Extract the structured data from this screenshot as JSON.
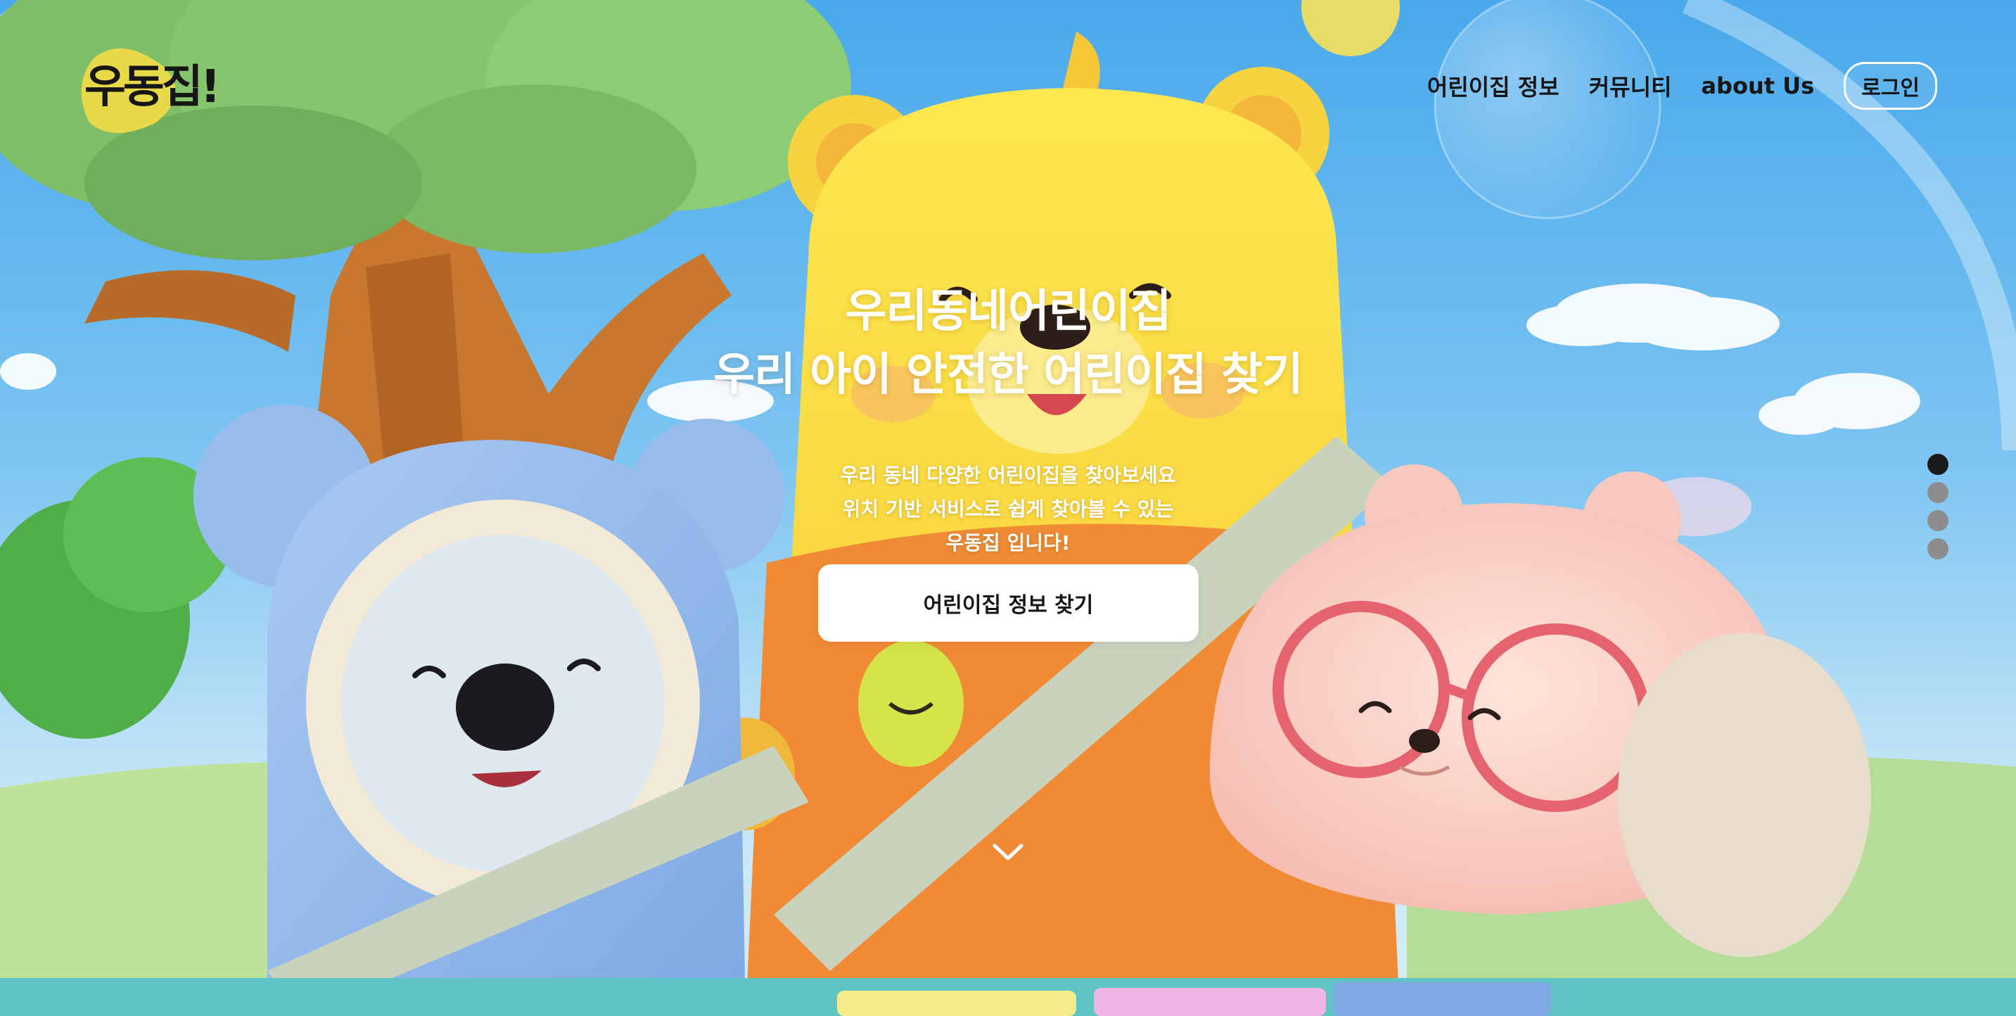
{
  "brand": {
    "logo_text": "우동집!",
    "logo_color": "#e8d94a"
  },
  "nav": {
    "items": [
      {
        "label": "어린이집 정보"
      },
      {
        "label": "커뮤니티"
      },
      {
        "label": "about Us"
      }
    ],
    "login_label": "로그인"
  },
  "hero": {
    "headline": [
      "우리동네어린이집",
      "우리 아이 안전한 어린이집 찾기"
    ],
    "subcopy": [
      "우리 동네 다양한 어린이집을 찾아보세요",
      "위치 기반 서비스로 쉽게 찾아볼 수 있는",
      "우동집 입니다!"
    ],
    "cta_label": "어린이집 정보 찾기",
    "scroll_icon": "chevron-down-icon"
  },
  "pagination": {
    "count": 4,
    "active_index": 0
  },
  "colors": {
    "sky": "#49a9ec",
    "bear_yellow": "#f9db45",
    "koala_blue": "#9ec3ef",
    "pink_beaver": "#f7cdc2",
    "glasses": "#e4636e",
    "text_dark": "#161616"
  }
}
